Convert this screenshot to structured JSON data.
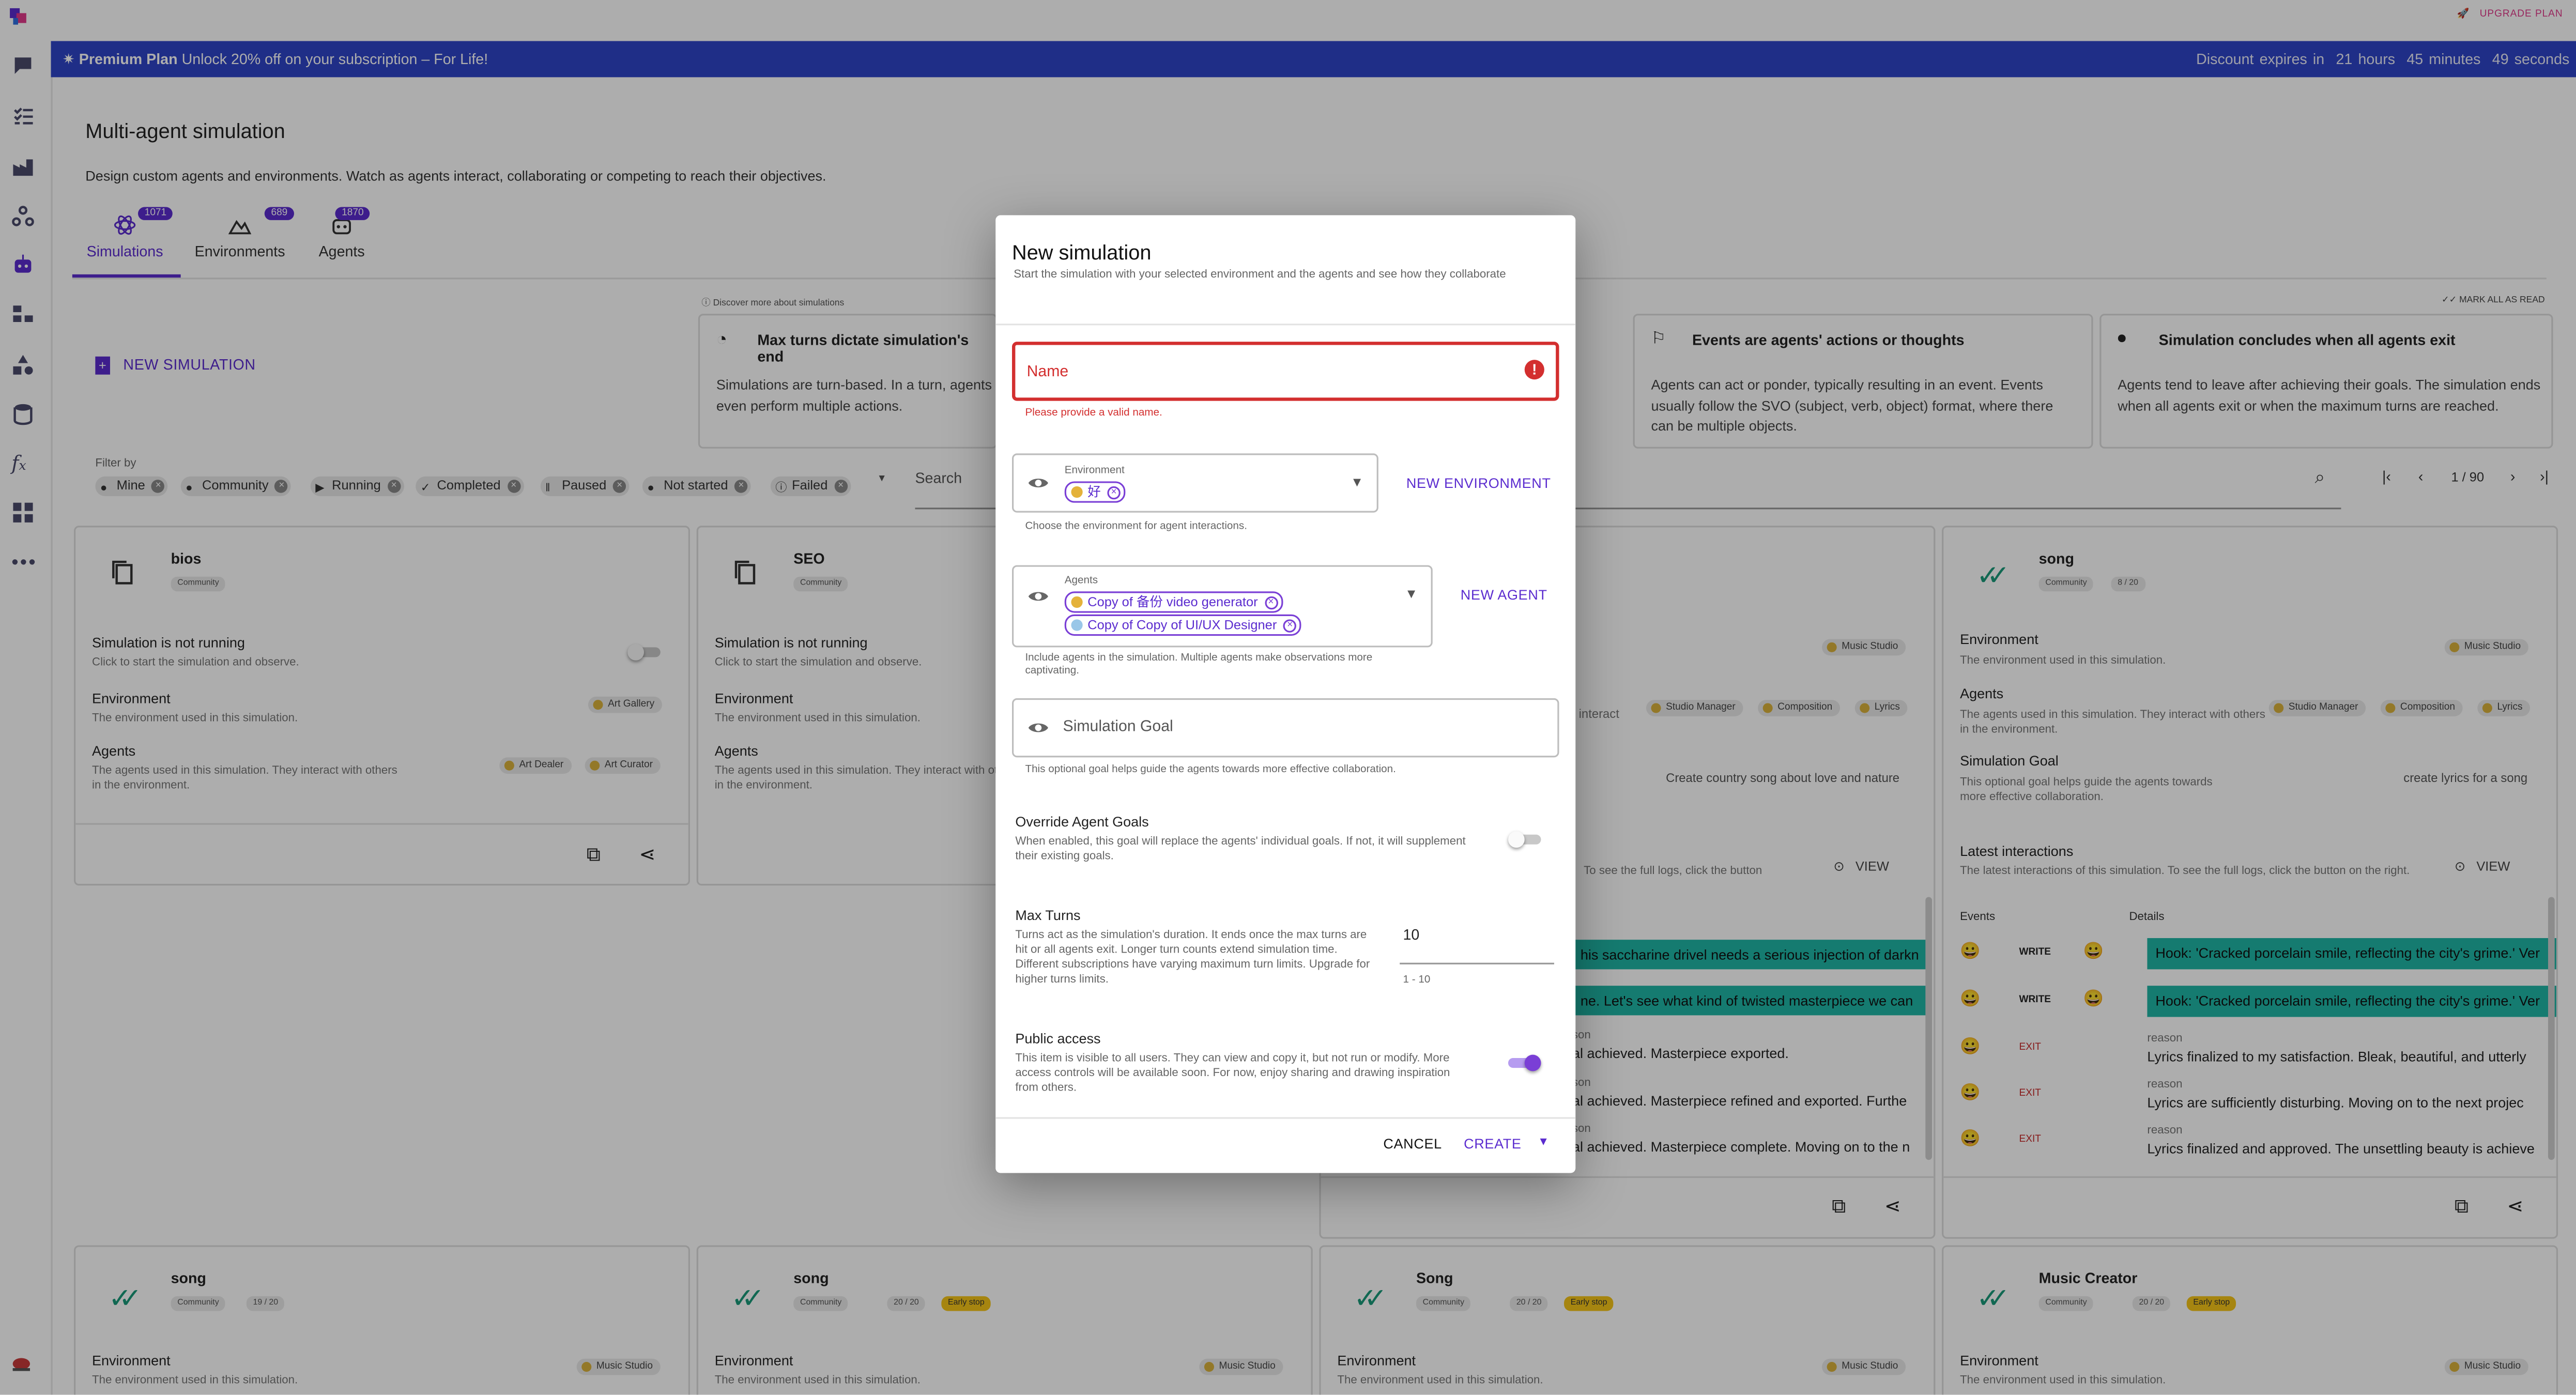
{
  "topbar": {
    "upgrade_label": "UPGRADE PLAN"
  },
  "banner": {
    "plan": "Premium Plan",
    "offer": "Unlock 20% off on your subscription – For Life!",
    "expires_label": "Discount expires in",
    "hours": "21 hours",
    "minutes": "45 minutes",
    "seconds": "49 seconds"
  },
  "page": {
    "title": "Multi-agent simulation",
    "subtitle": "Design custom agents and environments. Watch as agents interact, collaborating or competing to reach their objectives."
  },
  "tabs": [
    {
      "label": "Simulations",
      "count": "1071"
    },
    {
      "label": "Environments",
      "count": "689"
    },
    {
      "label": "Agents",
      "count": "1870"
    }
  ],
  "new_sim_label": "NEW SIMULATION",
  "discover_label": "Discover more about simulations",
  "mark_all_read": "MARK ALL AS READ",
  "info_cards": [
    {
      "title": "Max turns dictate simulation's end",
      "body": "Simulations are turn-based. In a turn, agents even perform multiple actions."
    },
    {
      "title": "Events are agents' actions or thoughts",
      "body": "Agents can act or ponder, typically resulting in an event. Events usually follow the SVO (subject, verb, object) format, where there can be multiple objects."
    },
    {
      "title": "Simulation concludes when all agents exit",
      "body": "Agents tend to leave after achieving their goals. The simulation ends when all agents exit or when the maximum turns are reached."
    }
  ],
  "filter": {
    "label": "Filter by",
    "chips": [
      "Mine",
      "Community",
      "Running",
      "Completed",
      "Paused",
      "Not started",
      "Failed"
    ]
  },
  "search": {
    "placeholder": "Search"
  },
  "pager": {
    "text": "1 / 90"
  },
  "cards": {
    "bios": {
      "title": "bios",
      "badge": "Community",
      "status": "Simulation is not running",
      "status_sub": "Click to start the simulation and observe.",
      "env_label": "Environment",
      "env_sub": "The environment used in this simulation.",
      "env_tag": "Art Gallery",
      "agents_label": "Agents",
      "agents_sub": "The agents used in this simulation. They interact with others in the environment.",
      "agent_tags": [
        "Art Dealer",
        "Art Curator"
      ]
    },
    "seo": {
      "title": "SEO",
      "badge": "Community",
      "status": "Simulation is not running",
      "status_sub": "Click to start the simulation and observe.",
      "env_label": "Environment",
      "env_sub": "The environment used in this simulation.",
      "agents_label": "Agents",
      "agents_sub": "The agents used in this simulation. They interact with others in the environment."
    },
    "mid": {
      "env_tag": "Music Studio",
      "interact_frag": "interact",
      "agent_tags": [
        "Studio Manager",
        "Composition",
        "Lyrics"
      ],
      "goal": "Create country song about love and nature",
      "logs_frag": "To see the full logs, click the button",
      "view": "VIEW",
      "msg1": "his saccharine drivel needs a serious injection of darkn",
      "msg2": "ne. Let's see what kind of twisted masterpiece we can",
      "reason_frag": "son",
      "r1": "al achieved. Masterpiece exported.",
      "r2": "al achieved. Masterpiece refined and exported. Furthe",
      "r3": "al achieved. Masterpiece complete. Moving on to the n"
    },
    "song_right": {
      "title": "song",
      "badge": "Community",
      "turns": "8 / 20",
      "env_label": "Environment",
      "env_sub": "The environment used in this simulation.",
      "env_tag": "Music Studio",
      "agents_label": "Agents",
      "agents_sub": "The agents used in this simulation. They interact with others in the environment.",
      "agent_tags": [
        "Studio Manager",
        "Composition",
        "Lyrics"
      ],
      "goal_label": "Simulation Goal",
      "goal_sub": "This optional goal helps guide the agents towards more effective collaboration.",
      "goal": "create lyrics for a song",
      "latest_label": "Latest interactions",
      "latest_sub": "The latest interactions of this simulation. To see the full logs, click the button on the right.",
      "view": "VIEW",
      "events_h": "Events",
      "details_h": "Details",
      "events": [
        {
          "verb": "WRITE",
          "detail": "Hook: 'Cracked porcelain smile, reflecting the city's grime.' Ver",
          "reason": ""
        },
        {
          "verb": "WRITE",
          "detail": "Hook: 'Cracked porcelain smile, reflecting the city's grime.' Ver",
          "reason": ""
        },
        {
          "verb": "EXIT",
          "detail": "Lyrics finalized to my satisfaction. Bleak, beautiful, and utterly",
          "reason": "reason"
        },
        {
          "verb": "EXIT",
          "detail": "Lyrics are sufficiently disturbing. Moving on to the next projec",
          "reason": "reason"
        },
        {
          "verb": "EXIT",
          "detail": "Lyrics finalized and approved. The unsettling beauty is achieve",
          "reason": "reason"
        }
      ]
    },
    "bottom": [
      {
        "title": "song",
        "badge": "Community",
        "turns": "19 / 20",
        "warn": "",
        "env_label": "Environment",
        "env_sub": "The environment used in this simulation.",
        "env_tag": "Music Studio"
      },
      {
        "title": "song",
        "badge": "Community",
        "turns": "20 / 20",
        "warn": "Early stop",
        "env_label": "Environment",
        "env_sub": "The environment used in this simulation.",
        "env_tag": "Music Studio"
      },
      {
        "title": "Song",
        "badge": "Community",
        "turns": "20 / 20",
        "warn": "Early stop",
        "env_label": "Environment",
        "env_sub": "The environment used in this simulation.",
        "env_tag": "Music Studio"
      },
      {
        "title": "Music Creator",
        "badge": "Community",
        "turns": "20 / 20",
        "warn": "Early stop",
        "env_label": "Environment",
        "env_sub": "The environment used in this simulation.",
        "env_tag": "Music Studio"
      }
    ]
  },
  "modal": {
    "title": "New simulation",
    "subtitle": "Start the simulation with your selected environment and the agents and see how they collaborate",
    "name_placeholder": "Name",
    "name_error": "Please provide a valid name.",
    "env_label": "Environment",
    "env_chip": "好",
    "env_helper": "Choose the environment for agent interactions.",
    "new_env": "NEW ENVIRONMENT",
    "agents_label": "Agents",
    "agent_chips": [
      "Copy of 备份 video generator",
      "Copy of Copy of UI/UX Designer"
    ],
    "agents_helper": "Include agents in the simulation. Multiple agents make observations more captivating.",
    "new_agent": "NEW AGENT",
    "goal_placeholder": "Simulation Goal",
    "goal_helper": "This optional goal helps guide the agents towards more effective collaboration.",
    "override_title": "Override Agent Goals",
    "override_desc": "When enabled, this goal will replace the agents' individual goals. If not, it will supplement their existing goals.",
    "maxturns_title": "Max Turns",
    "maxturns_desc": "Turns act as the simulation's duration. It ends once the max turns are hit or all agents exit. Longer turn counts extend simulation time. Different subscriptions have varying maximum turn limits. Upgrade for higher turns limits.",
    "maxturns_value": "10",
    "maxturns_range": "1 - 10",
    "public_title": "Public access",
    "public_desc": "This item is visible to all users. They can view and copy it, but not run or modify. More access controls will be available soon. For now, enjoy sharing and drawing inspiration from others.",
    "cancel": "CANCEL",
    "create": "CREATE"
  }
}
